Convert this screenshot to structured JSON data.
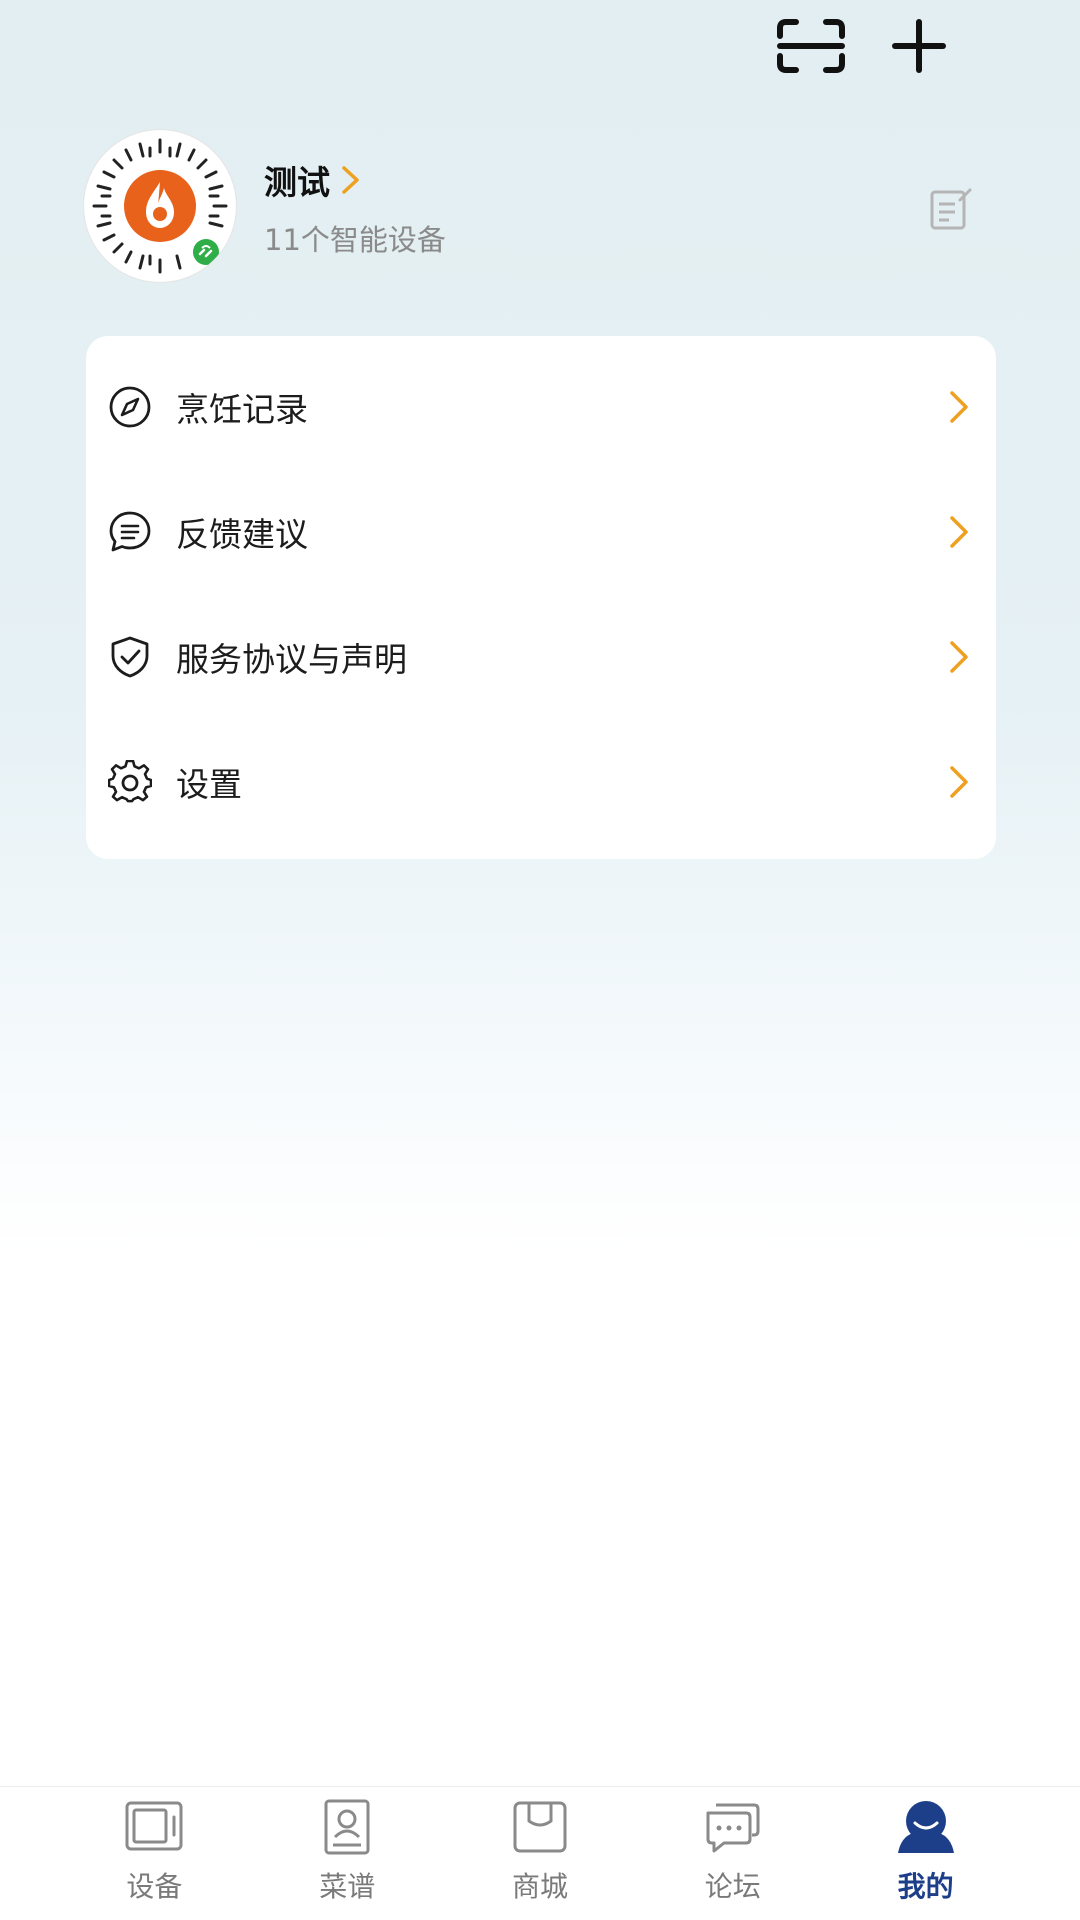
{
  "header": {
    "scan_icon": "scan-icon",
    "add_icon": "plus-icon"
  },
  "profile": {
    "name": "测试",
    "device_count_text": "11个智能设备",
    "avatar_icon": "mini-program-qr-avatar",
    "edit_icon": "edit-note-icon"
  },
  "menu": {
    "items": [
      {
        "label": "烹饪记录",
        "icon": "compass-icon"
      },
      {
        "label": "反馈建议",
        "icon": "chat-bubble-icon"
      },
      {
        "label": "服务协议与声明",
        "icon": "shield-check-icon"
      },
      {
        "label": "设置",
        "icon": "gear-icon"
      }
    ]
  },
  "tabbar": {
    "items": [
      {
        "label": "设备",
        "icon": "device-icon",
        "active": false
      },
      {
        "label": "菜谱",
        "icon": "recipe-icon",
        "active": false
      },
      {
        "label": "商城",
        "icon": "shop-icon",
        "active": false
      },
      {
        "label": "论坛",
        "icon": "forum-icon",
        "active": false
      },
      {
        "label": "我的",
        "icon": "profile-icon",
        "active": true
      }
    ]
  },
  "colors": {
    "accent_orange": "#f0a020",
    "active_tab": "#1d3f8a",
    "brand_orange": "#e8621c"
  }
}
